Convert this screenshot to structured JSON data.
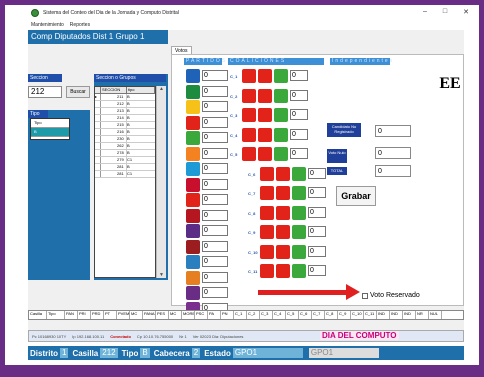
{
  "window": {
    "title": "Sistema del Conteo del Dia de la Jornada y Computo Distrital",
    "controls": [
      "–",
      "□",
      "✕"
    ]
  },
  "menu": [
    "Mantenimiento",
    "Reportes"
  ],
  "header_title": "Comp Diputados Dist 1 Grupo 1",
  "seccion_label": "Seccion",
  "seccion_value": "212",
  "buscar_label": "Buscar",
  "tipo_label": "Tipo",
  "tipo_options": [
    "Tipo",
    "B"
  ],
  "secciones_label": "Seccion o Grupos",
  "sec_columns": [
    "SECCION",
    "tipo"
  ],
  "sec_rows": [
    [
      "211",
      "B"
    ],
    [
      "212",
      "B"
    ],
    [
      "213",
      "B"
    ],
    [
      "214",
      "B"
    ],
    [
      "215",
      "B"
    ],
    [
      "216",
      "B"
    ],
    [
      "230",
      "B"
    ],
    [
      "262",
      "B"
    ],
    [
      "278",
      "B"
    ],
    [
      "279",
      "C1"
    ],
    [
      "281",
      "B"
    ],
    [
      "281",
      "C1"
    ]
  ],
  "tab_label": "Votos",
  "col_headers": [
    "PARTIDOS",
    "COALICIONES",
    "Independientes"
  ],
  "party_votes": [
    "0",
    "0",
    "0",
    "0",
    "0",
    "0",
    "0",
    "0",
    "0",
    "0",
    "0",
    "0",
    "0",
    "0",
    "0",
    "0"
  ],
  "coalitions": [
    {
      "label": "C_1",
      "value": "0"
    },
    {
      "label": "C_2",
      "value": "0"
    },
    {
      "label": "C_3",
      "value": "0"
    },
    {
      "label": "C_4",
      "value": "0"
    },
    {
      "label": "C_5",
      "value": "0"
    },
    {
      "label": "C_6",
      "value": "0"
    },
    {
      "label": "C_7",
      "value": "0"
    },
    {
      "label": "C_8",
      "value": "0"
    },
    {
      "label": "C_9",
      "value": "0"
    },
    {
      "label": "C_10",
      "value": "0"
    },
    {
      "label": "C_11",
      "value": "0"
    }
  ],
  "candidato_label": "Candidato No Registrado",
  "candidato_value": "0",
  "voto_nulo_label": "Voto Nulo",
  "voto_nulo_value": "0",
  "total_label": "TOTAL",
  "total_value": "0",
  "grabar_label": "Grabar",
  "logo_text": "EE",
  "voto_reservado_label": "Voto Reservado",
  "bottom_cols": [
    "Casilla",
    "Tipo",
    "PAN",
    "PRI",
    "PRD",
    "PT",
    "PVEM",
    "MC",
    "PANAL",
    "PES",
    "MC",
    "MORENA",
    "PSC",
    "PA",
    "PN",
    "C_1",
    "C_2",
    "C_3",
    "C_4",
    "C_5",
    "C_6",
    "C_7",
    "C_8",
    "C_9",
    "C_10",
    "C_11",
    "IND",
    "IND",
    "IND",
    "NR",
    "NUL"
  ],
  "info_strip": [
    "Pc 10168930 10TY",
    "Ip 192.168.100.11",
    "Conectado",
    "Cp 10.10.76.755000",
    "Nr 1",
    "Ver 02023 Dia: Diputaciones"
  ],
  "dia_computo": "DIA DEL COMPUTO",
  "status": {
    "distrito_label": "Distrito",
    "distrito_value": "1",
    "casilla_label": "Casilla",
    "casilla_value": "212",
    "tipo_label": "Tipo",
    "tipo_value": "B",
    "cabecera_label": "Cabecera",
    "cabecera_value": "2",
    "estado_label": "Estado",
    "estado_value": "GPO1",
    "extra_value": "GPO1"
  },
  "colors": {
    "frame": "#6a2d86",
    "blue": "#1f6faa",
    "accent_pink": "#c8007a",
    "arrow": "#e02020"
  }
}
